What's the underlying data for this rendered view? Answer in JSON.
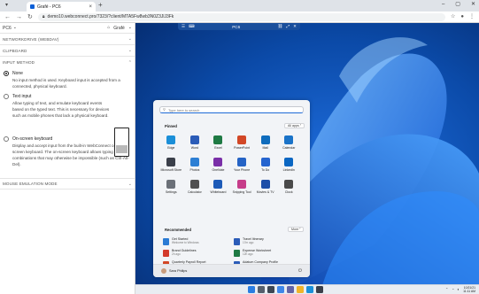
{
  "browser": {
    "tab_title": "Grafé - PC6",
    "url": "demo10.webconnect.pro/7323/?client/MTA5Fw8wb3N0Z3JlJ3Fk",
    "colors": {
      "tabstrip": "#dfe3e8",
      "accent": "#0b5fd7"
    }
  },
  "panel": {
    "machine": "PC6",
    "user": "Grafé",
    "sections": {
      "network": "NETWORKDRIVE (WEBDAV)",
      "clipboard": "CLIPBOARD",
      "input_method": "INPUT METHOD",
      "mouse": "MOUSE EMULATION MODE"
    },
    "options": [
      {
        "label": "None",
        "selected": true,
        "desc": "No input method is used. Keyboard input is accepted from a connected, physical keyboard."
      },
      {
        "label": "Text input",
        "selected": false,
        "desc": "Allow typing of text, and emulate keyboard events based on the typed text. This is necessary for devices such as mobile phones that lack a physical keyboard."
      },
      {
        "label": "On-screen keyboard",
        "selected": false,
        "desc": "Display and accept input from the built-in WebConnect on-screen keyboard. The on-screen keyboard allows typing of key combinations that may otherwise be impossible (such as Ctrl-Alt-Del)."
      }
    ]
  },
  "remote": {
    "toolbar_title": "PC6",
    "colors": {
      "desktop": "#0a3b8d",
      "bloom": "#1e7bff"
    },
    "start_menu": {
      "search_placeholder": "Type here to search",
      "pinned_title": "Pinned",
      "all_apps_label": "All apps",
      "recommended_title": "Recommended",
      "more_label": "More",
      "user_name": "Sara Philips",
      "pinned": [
        {
          "name": "Edge",
          "color": "#1b8fd8"
        },
        {
          "name": "Word",
          "color": "#2b5cb8"
        },
        {
          "name": "Excel",
          "color": "#1f7a44"
        },
        {
          "name": "PowerPoint",
          "color": "#d24726"
        },
        {
          "name": "Mail",
          "color": "#0f6cbd"
        },
        {
          "name": "Calendar",
          "color": "#1a73c8"
        },
        {
          "name": "Microsoft Store",
          "color": "#3a3f4a"
        },
        {
          "name": "Photos",
          "color": "#2d7fd4"
        },
        {
          "name": "OneNote",
          "color": "#7a2fa8"
        },
        {
          "name": "Your Phone",
          "color": "#2563c5"
        },
        {
          "name": "To Do",
          "color": "#2564cf"
        },
        {
          "name": "LinkedIn",
          "color": "#0a66c2"
        },
        {
          "name": "Settings",
          "color": "#6b7078"
        },
        {
          "name": "Calculator",
          "color": "#505050"
        },
        {
          "name": "Whiteboard",
          "color": "#1d5bb8"
        },
        {
          "name": "Snipping Tool",
          "color": "#c63d8a"
        },
        {
          "name": "Movies & TV",
          "color": "#1e4fa8"
        },
        {
          "name": "Clock",
          "color": "#4a4a4a"
        }
      ],
      "recommended": [
        {
          "title": "Get Started",
          "sub": "Welcome to Windows",
          "color": "#2b7bd4"
        },
        {
          "title": "Travel Itinerary",
          "sub": "17m ago",
          "color": "#2b5cb8"
        },
        {
          "title": "Brand Guidelines",
          "sub": "2h ago",
          "color": "#d33a2c"
        },
        {
          "title": "Expense Worksheet",
          "sub": "12h ago",
          "color": "#1f7a44"
        },
        {
          "title": "Quarterly Payroll Report",
          "sub": "Yesterday at 4:24 PM",
          "color": "#d24726"
        },
        {
          "title": "Adatum Company Profile",
          "sub": "Yesterday at 1:15 PM",
          "color": "#2b5cb8"
        }
      ]
    },
    "taskbar": {
      "icons": [
        {
          "name": "start",
          "color": "#2a7de1"
        },
        {
          "name": "search",
          "color": "#555f6d"
        },
        {
          "name": "task-view",
          "color": "#3c4654"
        },
        {
          "name": "widgets",
          "color": "#3f86e8"
        },
        {
          "name": "teams-chat",
          "color": "#6264a7"
        },
        {
          "name": "file-explorer",
          "color": "#f0b429"
        },
        {
          "name": "edge",
          "color": "#1b8fd8"
        },
        {
          "name": "store",
          "color": "#3a3f4a"
        }
      ],
      "date": "10/21/21",
      "time": "11:11 AM"
    }
  }
}
